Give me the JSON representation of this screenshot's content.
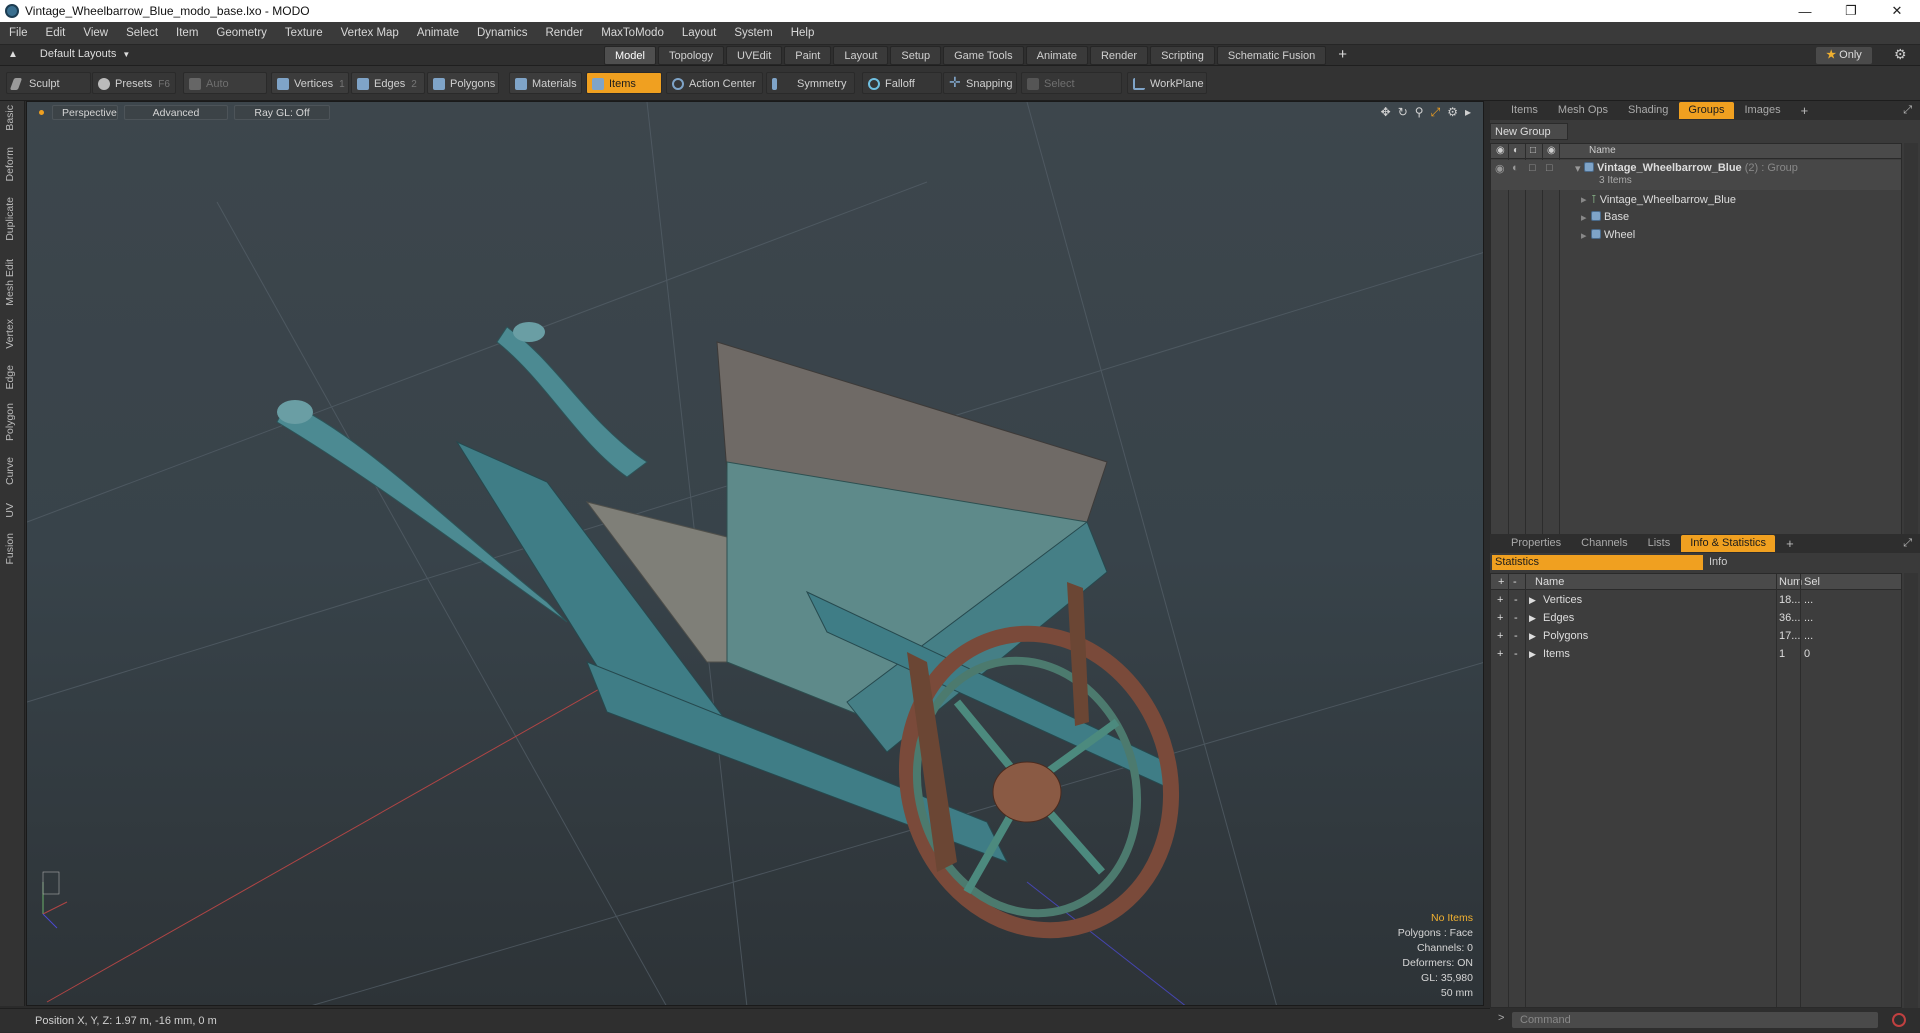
{
  "window": {
    "title": "Vintage_Wheelbarrow_Blue_modo_base.lxo - MODO"
  },
  "menu": [
    "File",
    "Edit",
    "View",
    "Select",
    "Item",
    "Geometry",
    "Texture",
    "Vertex Map",
    "Animate",
    "Dynamics",
    "Render",
    "MaxToModo",
    "Layout",
    "System",
    "Help"
  ],
  "layoutbar": {
    "layout_label": "Default Layouts",
    "tabs": [
      "Model",
      "Topology",
      "UVEdit",
      "Paint",
      "Layout",
      "Setup",
      "Game Tools",
      "Animate",
      "Render",
      "Scripting",
      "Schematic Fusion"
    ],
    "active_tab": "Model",
    "only_label": "Only"
  },
  "toolbar": {
    "sculpt": "Sculpt",
    "presets": "Presets",
    "presets_hotkey": "F6",
    "auto_select": "Auto Select",
    "vertices": "Vertices",
    "vertices_hotkey": "1",
    "edges": "Edges",
    "edges_hotkey": "2",
    "polygons": "Polygons",
    "materials": "Materials",
    "items": "Items",
    "action_center": "Action Center",
    "symmetry": "Symmetry",
    "falloff": "Falloff",
    "snapping": "Snapping",
    "select_through": "Select Through",
    "workplane": "WorkPlane"
  },
  "left_tabs": [
    "Basic",
    "Deform",
    "Duplicate",
    "Mesh Edit",
    "Vertex",
    "Edge",
    "Polygon",
    "Curve",
    "UV",
    "Fusion"
  ],
  "viewport": {
    "view_mode": "Perspective",
    "shading": "Advanced",
    "raygl": "Ray GL: Off",
    "info": {
      "selection": "No Items",
      "polygons": "Polygons : Face",
      "channels": "Channels: 0",
      "deformers": "Deformers: ON",
      "gl": "GL: 35,980",
      "focal": "50 mm"
    }
  },
  "status": {
    "position": "Position X, Y, Z:  1.97 m, -16 mm, 0 m"
  },
  "groups_panel": {
    "tabs": [
      "Items",
      "Mesh Ops",
      "Shading",
      "Groups",
      "Images"
    ],
    "active_tab": "Groups",
    "new_group": "New Group",
    "col_name": "Name",
    "group_name": "Vintage_Wheelbarrow_Blue",
    "group_suffix": "(2) : Group",
    "group_count": "3 Items",
    "children": [
      "Vintage_Wheelbarrow_Blue",
      "Base",
      "Wheel"
    ]
  },
  "stats_panel": {
    "tabs": [
      "Properties",
      "Channels",
      "Lists",
      "Info & Statistics"
    ],
    "active_tab": "Info & Statistics",
    "sub_statistics": "Statistics",
    "sub_info": "Info",
    "col_name": "Name",
    "col_num": "Num",
    "col_sel": "Sel",
    "rows": [
      {
        "name": "Vertices",
        "num": "18...",
        "sel": "..."
      },
      {
        "name": "Edges",
        "num": "36...",
        "sel": "..."
      },
      {
        "name": "Polygons",
        "num": "17...",
        "sel": "..."
      },
      {
        "name": "Items",
        "num": "1",
        "sel": "0"
      }
    ]
  },
  "command": {
    "placeholder": "Command"
  },
  "colors": {
    "accent": "#f0a020",
    "wheelbarrow_blue": "#3f7d86",
    "wheel_rust": "#7a4a3a"
  }
}
